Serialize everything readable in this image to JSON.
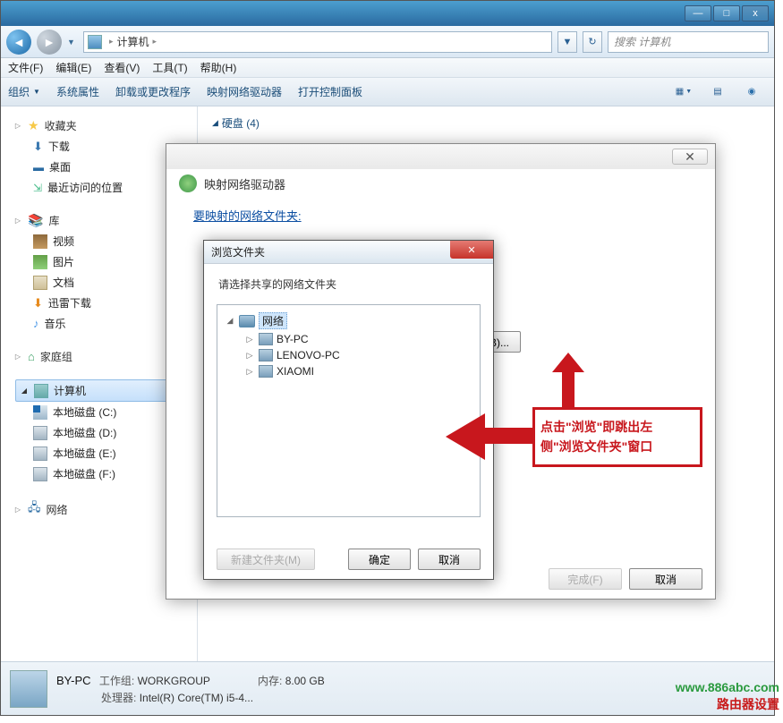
{
  "titlebar": {
    "min": "—",
    "max": "□",
    "close": "x"
  },
  "nav": {
    "breadcrumb_root": "计算机",
    "search_placeholder": "搜索 计算机"
  },
  "menubar": [
    "文件(F)",
    "编辑(E)",
    "查看(V)",
    "工具(T)",
    "帮助(H)"
  ],
  "toolbar": {
    "items": [
      "组织",
      "系统属性",
      "卸载或更改程序",
      "映射网络驱动器",
      "打开控制面板"
    ]
  },
  "sidebar": {
    "favorites": {
      "label": "收藏夹",
      "items": [
        "下载",
        "桌面",
        "最近访问的位置"
      ]
    },
    "libraries": {
      "label": "库",
      "items": [
        "视频",
        "图片",
        "文档",
        "迅雷下载",
        "音乐"
      ]
    },
    "homegroup": {
      "label": "家庭组"
    },
    "computer": {
      "label": "计算机",
      "items": [
        "本地磁盘 (C:)",
        "本地磁盘 (D:)",
        "本地磁盘 (E:)",
        "本地磁盘 (F:)"
      ]
    },
    "network": {
      "label": "网络"
    }
  },
  "main": {
    "section": "硬盘 (4)",
    "drives": [
      "本地磁盘 (C:)",
      "本地磁盘 (D:)"
    ]
  },
  "bottom": {
    "name": "BY-PC",
    "workgroup_label": "工作组:",
    "workgroup_value": "WORKGROUP",
    "mem_label": "内存:",
    "mem_value": "8.00 GB",
    "cpu_label": "处理器:",
    "cpu_value": "Intel(R) Core(TM) i5-4..."
  },
  "dlg_map": {
    "title": "映射网络驱动器",
    "link": "要映射的网络文件夹:",
    "browse": "浏览(B)...",
    "finish": "完成(F)",
    "cancel": "取消"
  },
  "dlg_browse": {
    "title": "浏览文件夹",
    "msg": "请选择共享的网络文件夹",
    "root": "网络",
    "items": [
      "BY-PC",
      "LENOVO-PC",
      "XIAOMI"
    ],
    "new": "新建文件夹(M)",
    "ok": "确定",
    "cancel": "取消"
  },
  "anno": {
    "line1": "点击\"浏览\"即跳出左",
    "line2": "侧\"浏览文件夹\"窗口"
  },
  "watermark": {
    "w1": "www.886abc.com",
    "w2": "路由器设置"
  }
}
